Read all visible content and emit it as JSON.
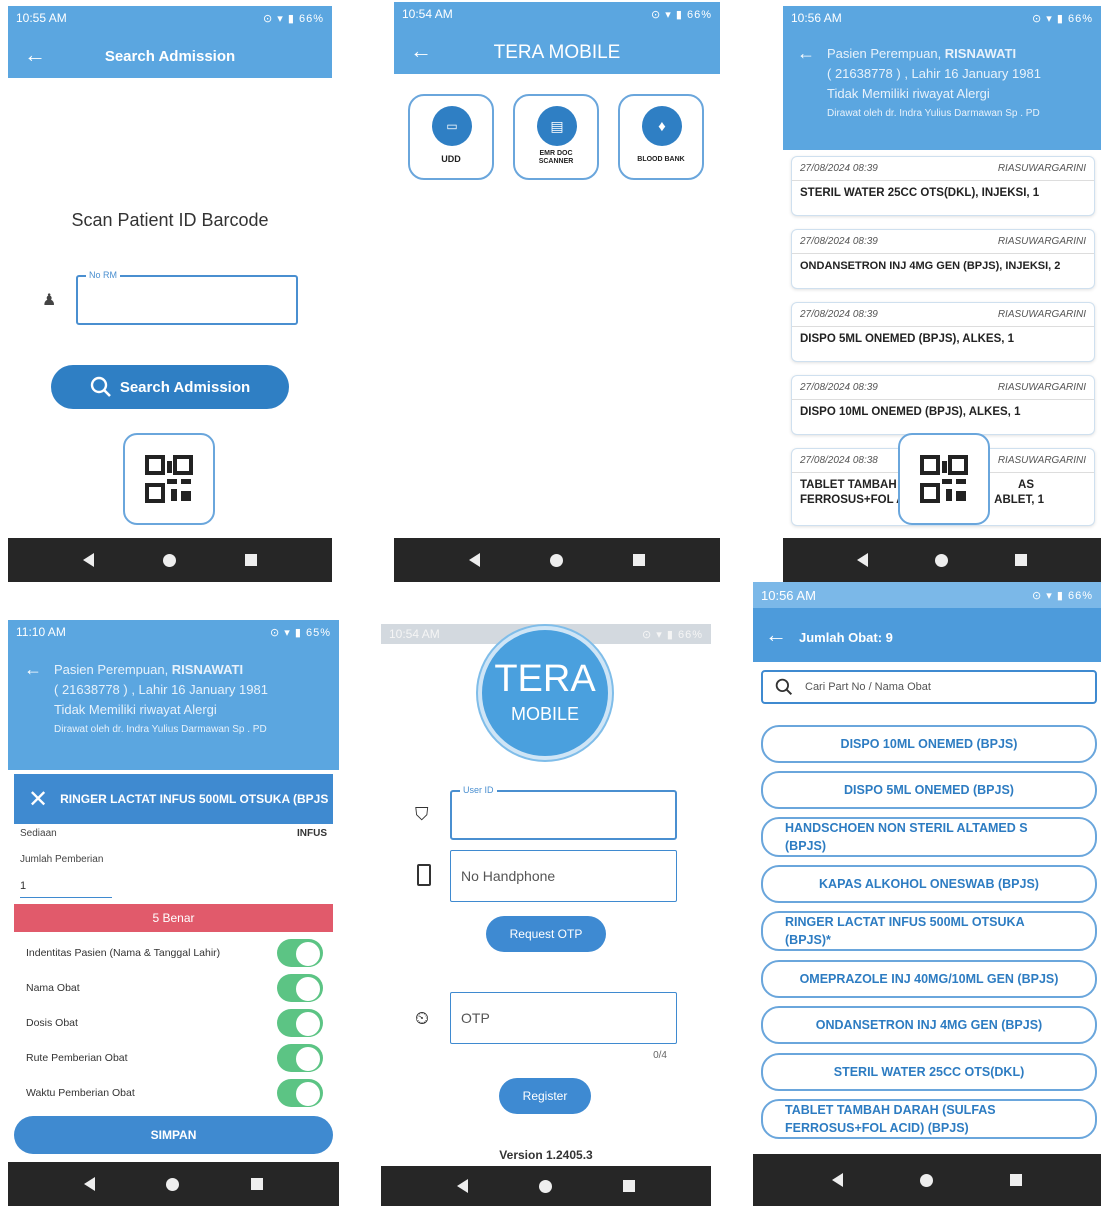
{
  "colors": {
    "primary": "#5ba6e0",
    "button": "#2f7fc4",
    "danger": "#e15a6b",
    "toggle_on": "#5cc484",
    "nav": "#262626"
  },
  "s1": {
    "time": "10:55 AM",
    "battery": "66%",
    "title": "Search Admission",
    "scan_title": "Scan Patient ID Barcode",
    "field_label": "No RM",
    "search_button": "Search Admission"
  },
  "s2": {
    "time": "10:54 AM",
    "battery": "66%",
    "title": "TERA MOBILE",
    "tiles": [
      {
        "icon": "udd-icon",
        "label": "UDD"
      },
      {
        "icon": "emr-doc-scanner-icon",
        "label": "EMR DOC SCANNER"
      },
      {
        "icon": "blood-bank-icon",
        "label": "BLOOD BANK"
      }
    ]
  },
  "s3": {
    "time": "10:56 AM",
    "battery": "66%",
    "patient_line1_prefix": "Pasien Perempuan, ",
    "patient_name": "RISNAWATI",
    "patient_line2": "( 21638778 ) , Lahir 16 January 1981",
    "patient_line3": "Tidak Memiliki riwayat Alergi",
    "patient_line4": "Dirawat oleh dr. Indra Yulius Darmawan Sp . PD",
    "cards": [
      {
        "datetime": "27/08/2024  08:39",
        "nurse": "RIASUWARGARINI",
        "name": "STERIL WATER 25CC OTS(DKL), INJEKSI, 1"
      },
      {
        "datetime": "27/08/2024  08:39",
        "nurse": "RIASUWARGARINI",
        "name": "ONDANSETRON INJ 4MG GEN (BPJS), INJEKSI, 2"
      },
      {
        "datetime": "27/08/2024  08:39",
        "nurse": "RIASUWARGARINI",
        "name": "DISPO 5ML ONEMED (BPJS), ALKES, 1"
      },
      {
        "datetime": "27/08/2024  08:39",
        "nurse": "RIASUWARGARINI",
        "name": "DISPO 10ML ONEMED (BPJS), ALKES, 1"
      },
      {
        "datetime": "27/08/2024  08:38",
        "nurse": "RIASUWARGARINI",
        "name1": "TABLET TAMBAH",
        "name1b": "AS",
        "name2": "FERROSUS+FOL A",
        "name2b": "ABLET, 1"
      }
    ]
  },
  "s4": {
    "time": "11:10 AM",
    "battery": "65%",
    "patient_line1_prefix": "Pasien Perempuan, ",
    "patient_name": "RISNAWATI",
    "patient_line2": "( 21638778 ) , Lahir 16 January 1981",
    "patient_line3": "Tidak Memiliki riwayat Alergi",
    "patient_line4": "Dirawat oleh dr. Indra Yulius Darmawan Sp . PD",
    "dialog_title": "RINGER LACTAT INFUS 500ML OTSUKA (BPJS",
    "sediaan_label": "Sediaan",
    "sediaan_value": "INFUS",
    "jumlah_label": "Jumlah Pemberian",
    "jumlah_value": "1",
    "banner": "5 Benar",
    "checks": [
      "Indentitas Pasien (Nama & Tanggal Lahir)",
      "Nama Obat",
      "Dosis Obat",
      "Rute Pemberian Obat",
      "Waktu Pemberian Obat"
    ],
    "save_button": "SIMPAN"
  },
  "s5": {
    "time": "10:54 AM",
    "battery": "66%",
    "logo_top": "TERA",
    "logo_bottom": "MOBILE",
    "user_id_label": "User ID",
    "phone_placeholder": "No Handphone",
    "request_otp": "Request OTP",
    "otp_placeholder": "OTP",
    "otp_counter": "0/4",
    "register": "Register",
    "version": "Version 1.2405.3"
  },
  "s6": {
    "time": "10:56 AM",
    "battery": "66%",
    "title": "Jumlah Obat: 9",
    "search_placeholder": "Cari Part No / Nama Obat",
    "drugs": [
      "DISPO 10ML ONEMED (BPJS)",
      "DISPO 5ML ONEMED (BPJS)",
      "HANDSCHOEN NON STERIL ALTAMED S (BPJS)",
      "KAPAS ALKOHOL ONESWAB (BPJS)",
      "RINGER LACTAT INFUS 500ML OTSUKA (BPJS)*",
      "OMEPRAZOLE INJ 40MG/10ML GEN (BPJS)",
      "ONDANSETRON INJ 4MG GEN (BPJS)",
      "STERIL WATER 25CC OTS(DKL)",
      "TABLET TAMBAH DARAH (SULFAS FERROSUS+FOL ACID) (BPJS)"
    ]
  }
}
